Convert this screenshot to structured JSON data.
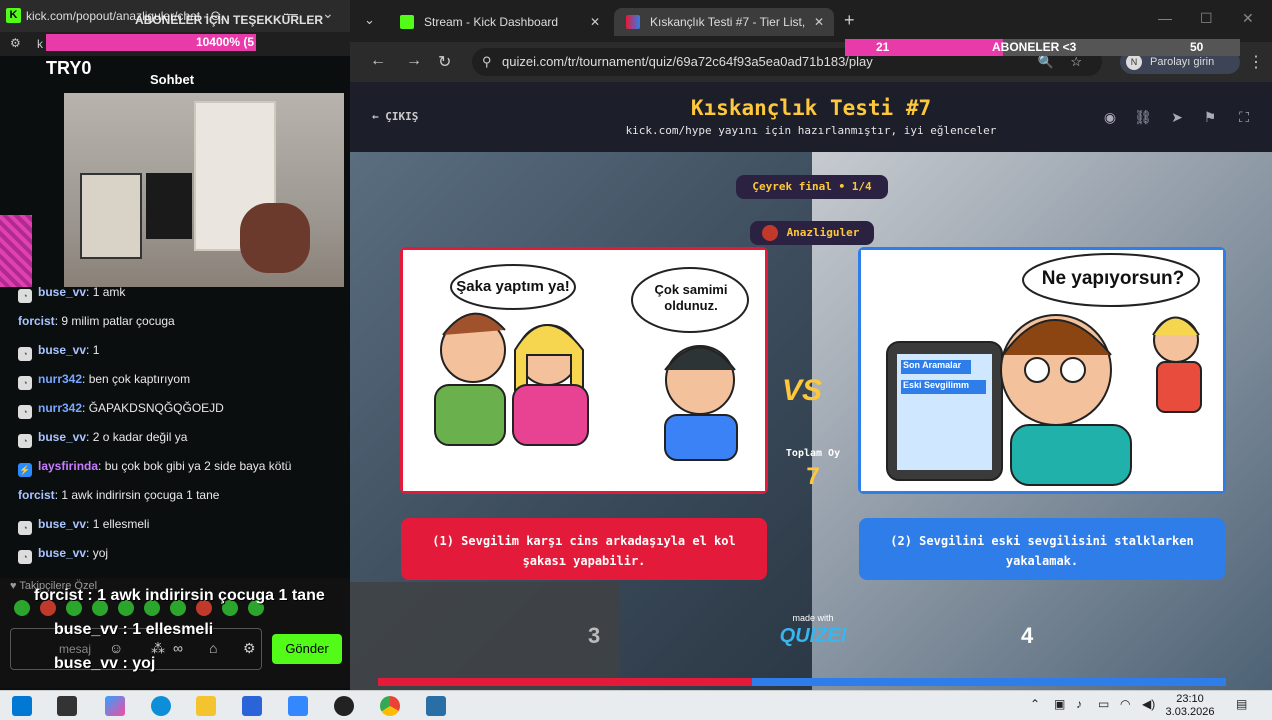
{
  "popout": {
    "title": "kick.com/popout/anazliguler/chat - G...",
    "url_text": "k",
    "overlay_text": "ABONELER İÇİN TEŞEKKÜRLER",
    "progress_label": "10400% (5",
    "streamer_name": "TRY0",
    "chat_header": "Sohbet",
    "messages": [
      {
        "user": "buse_vv",
        "text": ": 1 amk",
        "color": "#a9c4ff"
      },
      {
        "user": "forcist",
        "text": ": 9 milim patlar çocuga",
        "color": "#a9c4ff"
      },
      {
        "user": "buse_vv",
        "text": ": 1",
        "color": "#a9c4ff"
      },
      {
        "user": "nurr342",
        "text": ": ben çok kaptırıyom",
        "color": "#7aa7ff"
      },
      {
        "user": "nurr342",
        "text": ": ĞAPAKDSNQĞQĞOEJD",
        "color": "#7aa7ff"
      },
      {
        "user": "buse_vv",
        "text": ": 2 o kadar değil ya",
        "color": "#a9c4ff"
      },
      {
        "user": "laysfirinda",
        "text": ": bu çok bok gibi ya 2 side baya kötü",
        "color": "#c77dff"
      },
      {
        "user": "forcist",
        "text": ": 1 awk indirirsin çocuga 1 tane",
        "color": "#a9c4ff"
      },
      {
        "user": "buse_vv",
        "text": ": 1 ellesmeli",
        "color": "#a9c4ff"
      },
      {
        "user": "buse_vv",
        "text": ": yoj",
        "color": "#a9c4ff"
      }
    ],
    "followers_only": "Takipçilere Özel",
    "overlay_messages": [
      "forcist : 1 awk indirirsin çocuga 1 tane",
      "buse_vv : 1 ellesmeli",
      "buse_vv : yoj"
    ],
    "message_placeholder": "mesaj",
    "send_label": "Gönder"
  },
  "browser": {
    "tabs": [
      {
        "title": "Stream - Kick Dashboard",
        "active": false
      },
      {
        "title": "Kıskançlık Testi #7 - Tier List, Kö",
        "active": true
      }
    ],
    "url": "quizei.com/tr/tournament/quiz/69a72c64f93a5ea0ad71b183/play",
    "password_label": "Parolayı girin",
    "sub_overlay": {
      "left_num": "21",
      "label": "ABONELER <3",
      "right_num": "50"
    }
  },
  "quiz": {
    "exit_label": "ÇIKIŞ",
    "title": "Kıskançlık Testi #7",
    "subtitle": "kick.com/hype yayını için hazırlanmıştır, iyi eğlenceler",
    "round": "Çeyrek final • 1/4",
    "author": "Anazliguler",
    "left_bubble1": "Şaka yaptım ya!",
    "left_bubble2": "Çok samimi oldunuz.",
    "right_bubble": "Ne yapıyorsun?",
    "phone_label1": "Son Aramalar",
    "phone_label2": "Eski Sevgilimm",
    "vs": "VS",
    "total_label": "Toplam Oy",
    "total_votes": "7",
    "option1": "(1) Sevgilim karşı cins arkadaşıyla el kol şakası yapabilir.",
    "option2": "(2) Sevgilini eski sevgilisini stalklarken yakalamak.",
    "count_left": "3",
    "count_right": "4",
    "made_with": "made with",
    "brand": "QUIZEI"
  },
  "taskbar": {
    "time": "23:10",
    "date": "3.03.2026"
  }
}
